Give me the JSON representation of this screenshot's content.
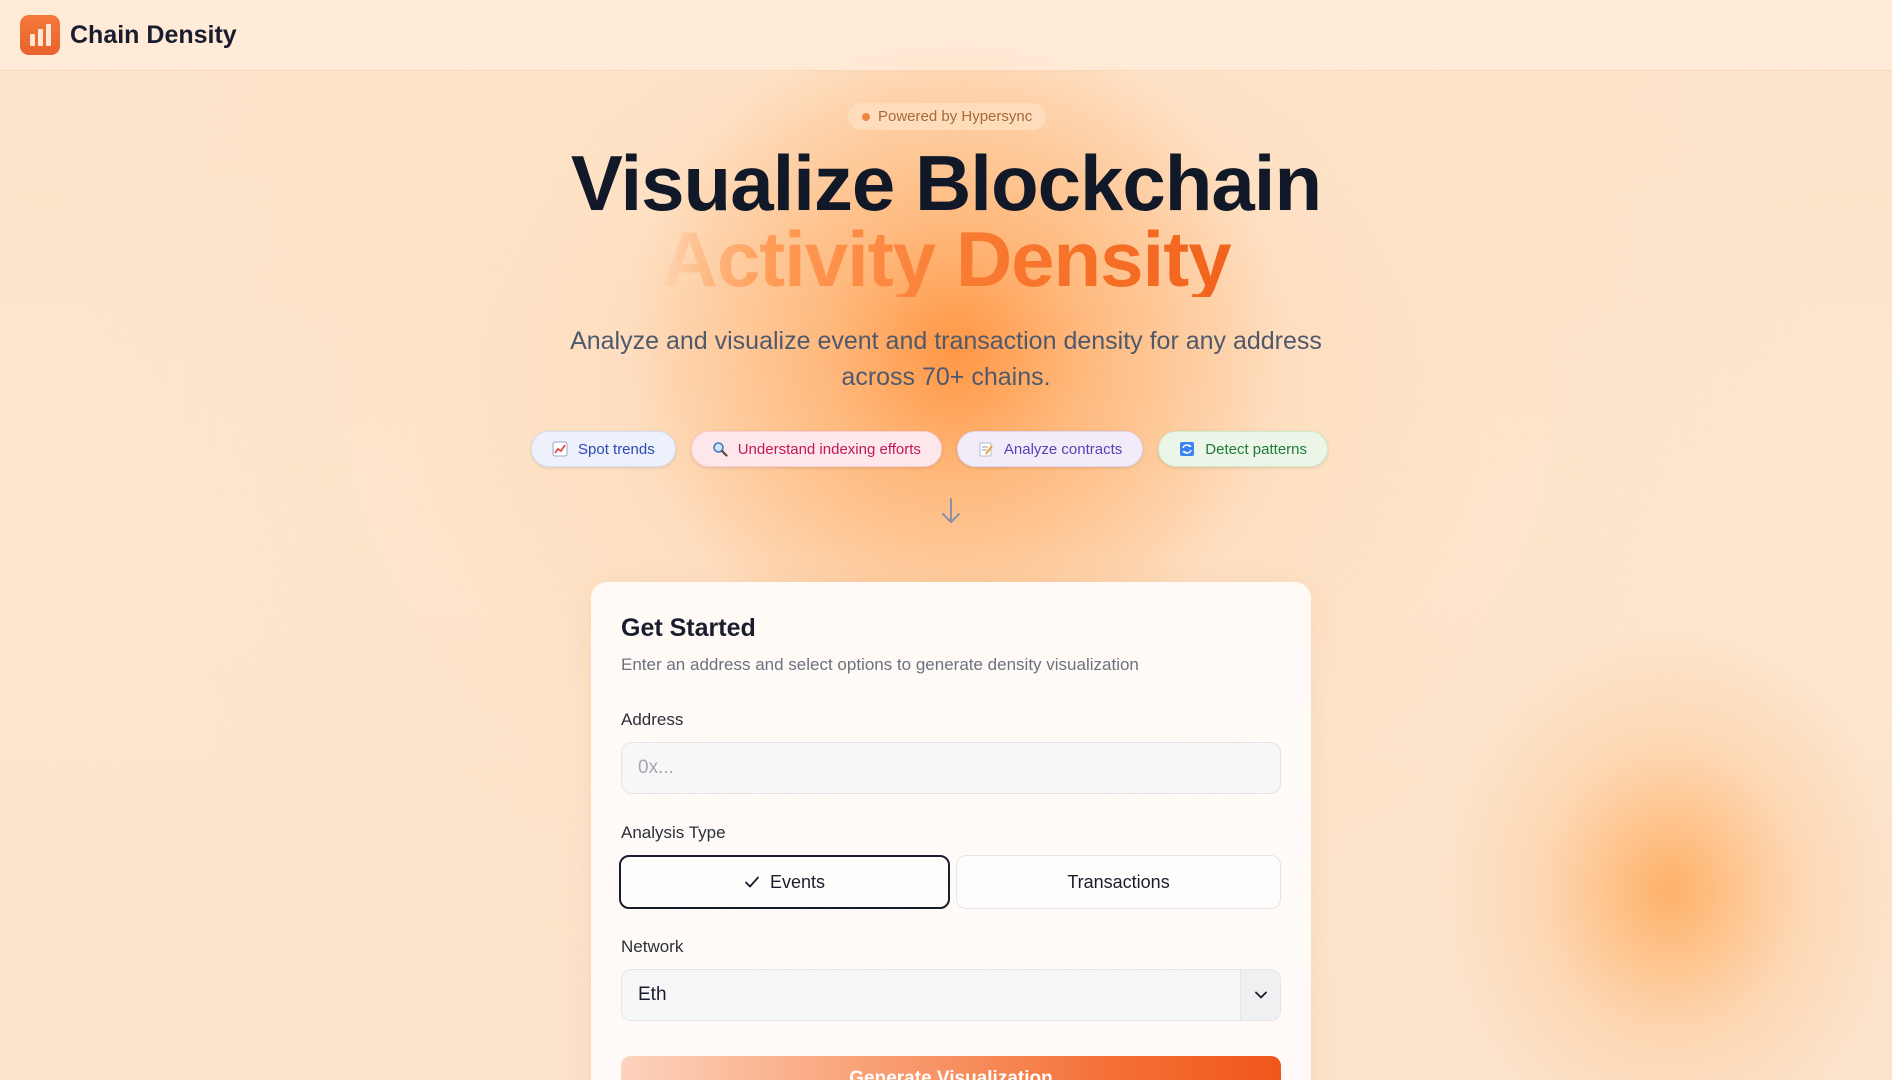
{
  "header": {
    "brand": "Chain Density",
    "logo_icon": "bar-chart-icon"
  },
  "hero": {
    "badge": "Powered by Hypersync",
    "title_line1": "Visualize Blockchain",
    "title_line2": "Activity Density",
    "subtitle": "Analyze and visualize event and transaction density for any address across 70+ chains."
  },
  "pills": [
    {
      "label": "Spot trends",
      "icon": "chart-increasing-icon"
    },
    {
      "label": "Understand indexing efforts",
      "icon": "magnifier-icon"
    },
    {
      "label": "Analyze contracts",
      "icon": "memo-icon"
    },
    {
      "label": "Detect patterns",
      "icon": "repeat-icon"
    }
  ],
  "form": {
    "title": "Get Started",
    "description": "Enter an address and select options to generate density visualization",
    "address_label": "Address",
    "address_placeholder": "0x...",
    "address_value": "",
    "analysis_label": "Analysis Type",
    "analysis_options": [
      "Events",
      "Transactions"
    ],
    "analysis_selected": "Events",
    "network_label": "Network",
    "network_value": "Eth",
    "submit_label": "Generate Visualization"
  },
  "colors": {
    "accent": "#f46f36",
    "title_dark": "#111827",
    "background": "#fde4cb"
  }
}
